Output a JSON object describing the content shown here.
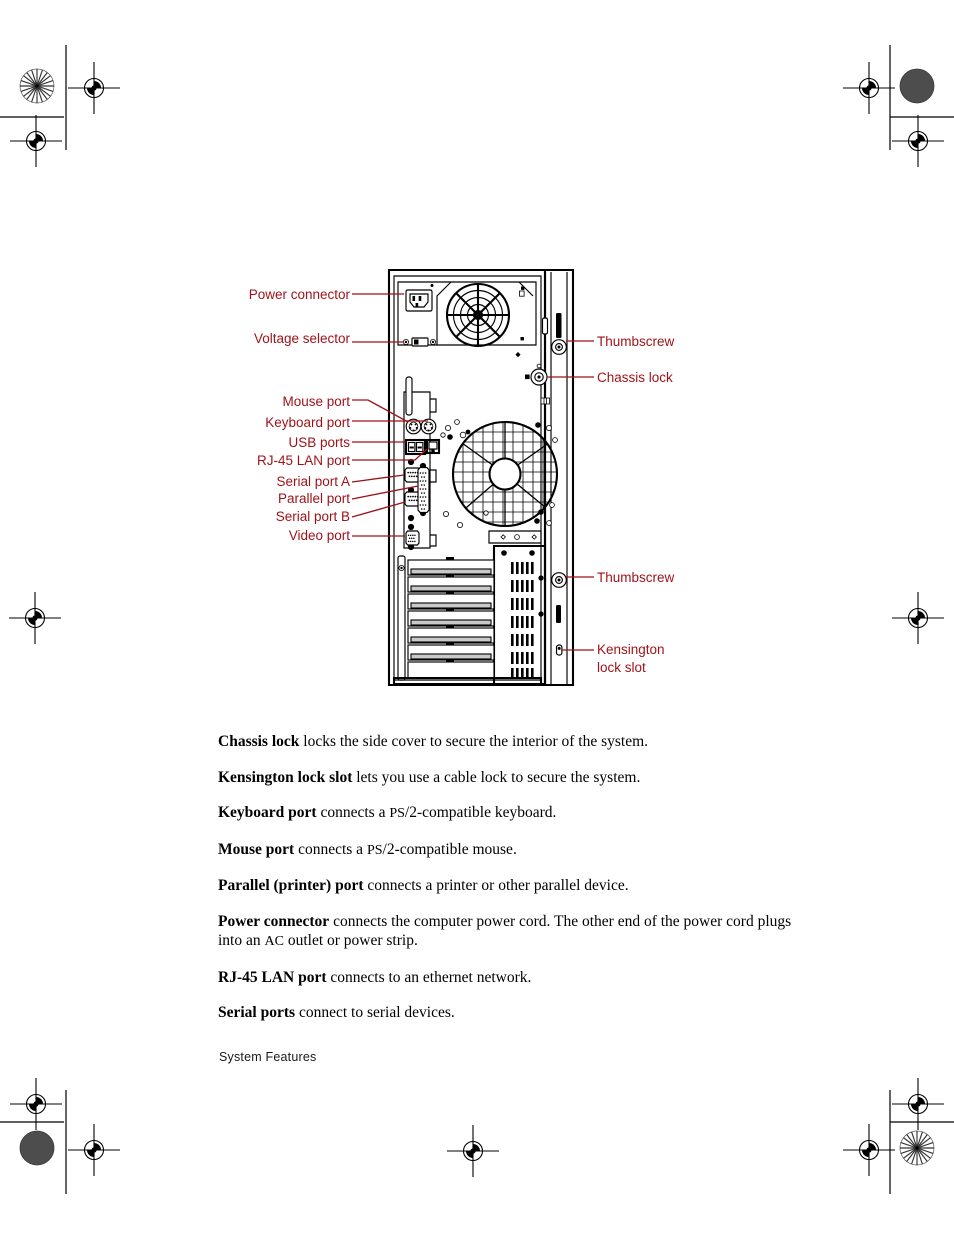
{
  "page": {
    "footer_label": "System Features",
    "label_color": "#9e1118",
    "line_color": "#000000"
  },
  "figure": {
    "name": "rear-panel-diagram",
    "callouts_left": [
      {
        "key": "power-connector",
        "label": "Power connector"
      },
      {
        "key": "voltage-selector",
        "label": "Voltage selector"
      },
      {
        "key": "mouse-port",
        "label": "Mouse port"
      },
      {
        "key": "keyboard-port",
        "label": "Keyboard port"
      },
      {
        "key": "usb-ports",
        "label": "USB ports"
      },
      {
        "key": "rj45-lan-port",
        "label": "RJ-45 LAN port"
      },
      {
        "key": "serial-port-a",
        "label": "Serial port A"
      },
      {
        "key": "parallel-port",
        "label": "Parallel port"
      },
      {
        "key": "serial-port-b",
        "label": "Serial port B"
      },
      {
        "key": "video-port",
        "label": "Video port"
      }
    ],
    "callouts_right": [
      {
        "key": "thumbscrew-top",
        "label": "Thumbscrew"
      },
      {
        "key": "chassis-lock",
        "label": "Chassis lock"
      },
      {
        "key": "thumbscrew-bottom",
        "label": "Thumbscrew"
      },
      {
        "key": "kensington-lock-slot-line1",
        "label": "Kensington"
      },
      {
        "key": "kensington-lock-slot-line2",
        "label": "lock slot"
      }
    ]
  },
  "descriptions": [
    {
      "term": "Chassis lock",
      "rest": " locks the side cover to secure the interior of the system."
    },
    {
      "term": "Kensington lock slot",
      "rest": " lets you use a cable lock to secure the system."
    },
    {
      "term": "Keyboard port",
      "rest_a": " connects a ",
      "sc": "PS",
      "rest_b": "/2-compatible keyboard."
    },
    {
      "term": "Mouse port",
      "rest_a": " connects a ",
      "sc": "PS",
      "rest_b": "/2-compatible mouse."
    },
    {
      "term": "Parallel (printer) port",
      "rest": " connects a printer or other parallel device."
    },
    {
      "term": "Power connector",
      "rest_a": " connects the computer power cord. The other end of the power cord plugs into an ",
      "sc": "AC",
      "rest_b": " outlet or power strip."
    },
    {
      "term": "RJ-45 LAN port",
      "rest": " connects to an ethernet network."
    },
    {
      "term": "Serial ports",
      "rest": " connect to serial devices."
    }
  ]
}
